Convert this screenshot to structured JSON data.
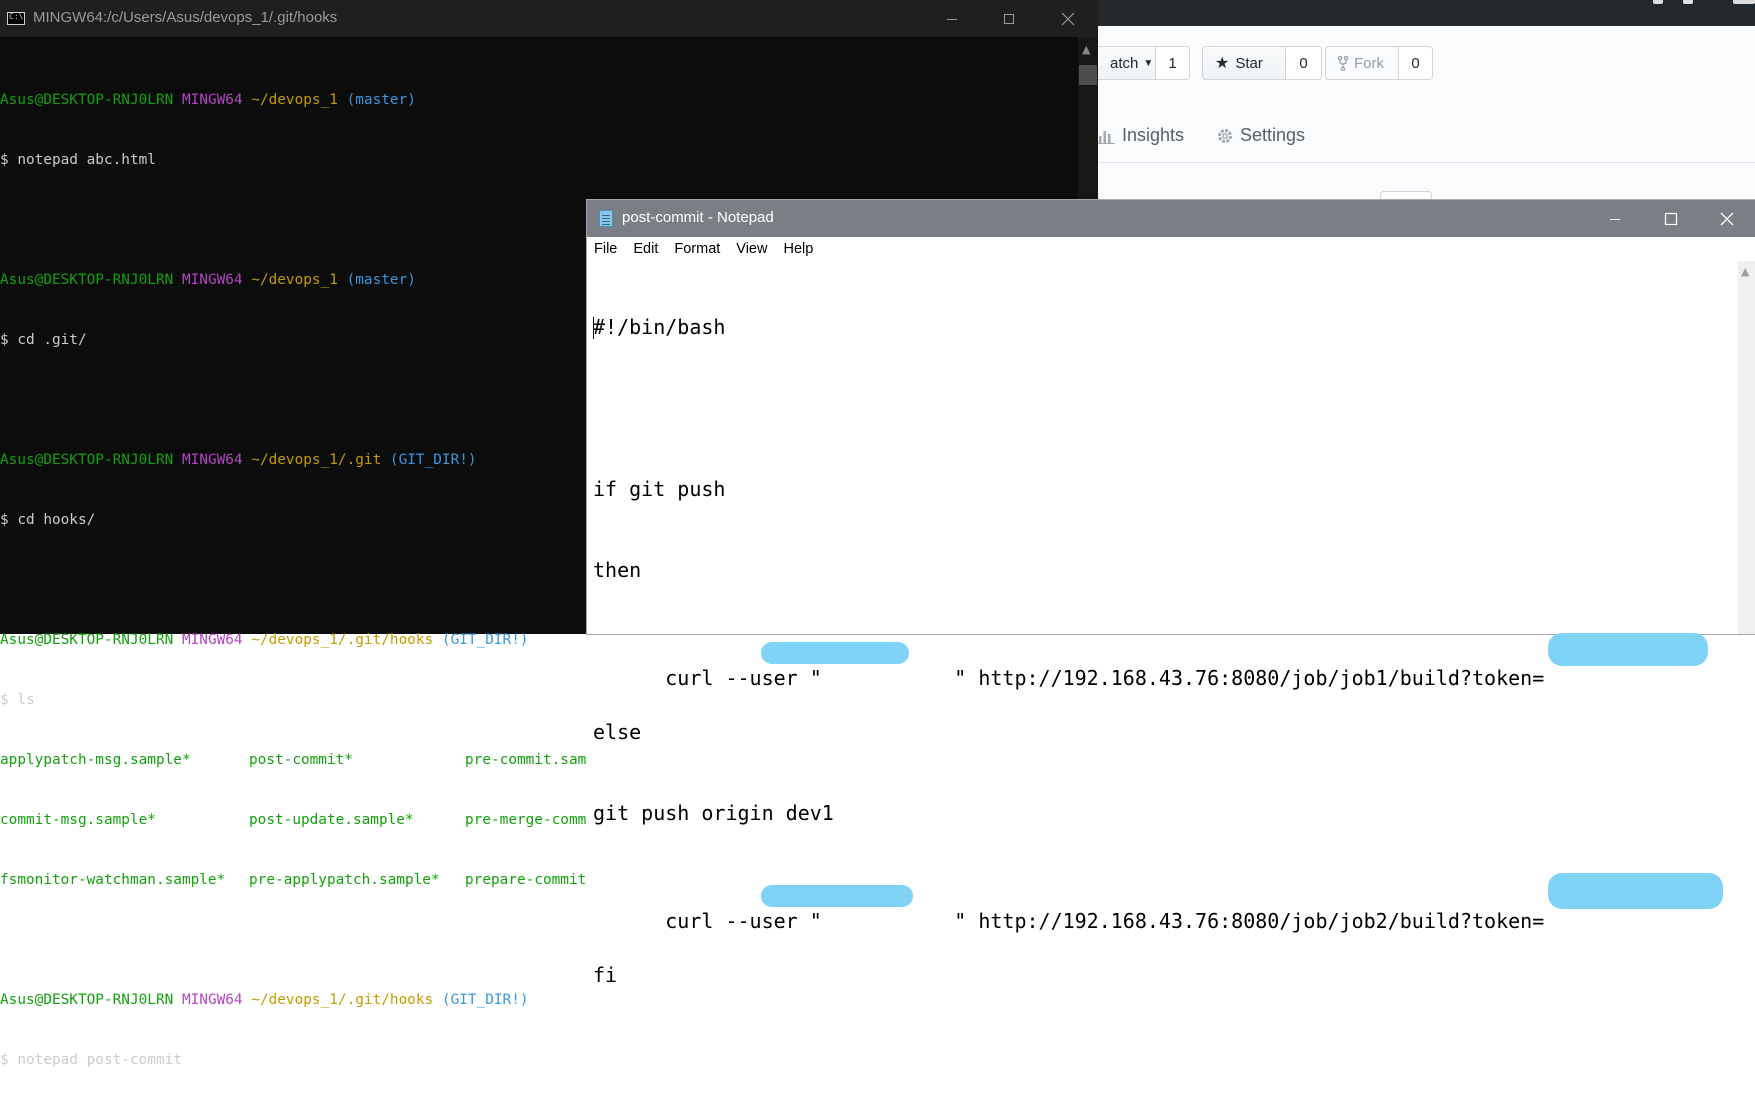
{
  "github": {
    "watch_label": "atch",
    "watch_count": "1",
    "star_label": "Star",
    "star_count": "0",
    "fork_label": "Fork",
    "fork_count": "0",
    "nav_insights": "Insights",
    "nav_settings": "Settings"
  },
  "terminal": {
    "title": "MINGW64:/c/Users/Asus/devops_1/.git/hooks",
    "prompts": [
      {
        "user": "Asus@DESKTOP-RNJ0LRN",
        "shell": "MINGW64",
        "path": "~/devops_1",
        "branch": "(master)",
        "cmd": "$ notepad abc.html"
      },
      {
        "user": "Asus@DESKTOP-RNJ0LRN",
        "shell": "MINGW64",
        "path": "~/devops_1",
        "branch": "(master)",
        "cmd": "$ cd .git/"
      },
      {
        "user": "Asus@DESKTOP-RNJ0LRN",
        "shell": "MINGW64",
        "path": "~/devops_1/.git",
        "branch": "(GIT_DIR!)",
        "cmd": "$ cd hooks/"
      },
      {
        "user": "Asus@DESKTOP-RNJ0LRN",
        "shell": "MINGW64",
        "path": "~/devops_1/.git/hooks",
        "branch": "(GIT_DIR!)",
        "cmd": "$ ls"
      },
      {
        "user": "Asus@DESKTOP-RNJ0LRN",
        "shell": "MINGW64",
        "path": "~/devops_1/.git/hooks",
        "branch": "(GIT_DIR!)",
        "cmd": "$ notepad post-commit"
      }
    ],
    "ls_rows": [
      [
        "applypatch-msg.sample*",
        "post-commit*",
        "pre-commit.sam"
      ],
      [
        "commit-msg.sample*",
        "post-update.sample*",
        "pre-merge-comm"
      ],
      [
        "fsmonitor-watchman.sample*",
        "pre-applypatch.sample*",
        "prepare-commit"
      ]
    ]
  },
  "notepad": {
    "title": "post-commit - Notepad",
    "menu": [
      "File",
      "Edit",
      "Format",
      "View",
      "Help"
    ],
    "lines": [
      "#!/bin/bash",
      "",
      "if git push",
      "then",
      "curl --user \"           \" http://192.168.43.76:8080/job/job1/build?token=",
      "else",
      "git push origin dev1",
      "curl --user \"           \" http://192.168.43.76:8080/job/job2/build?token=",
      "fi"
    ]
  },
  "colors": {
    "terminal_bg": "#0c0c0c",
    "prompt_user": "#13a10e",
    "prompt_shell": "#b146c2",
    "prompt_path": "#c19c00",
    "prompt_branch": "#3a96dd",
    "redaction": "#7fd3f7"
  }
}
